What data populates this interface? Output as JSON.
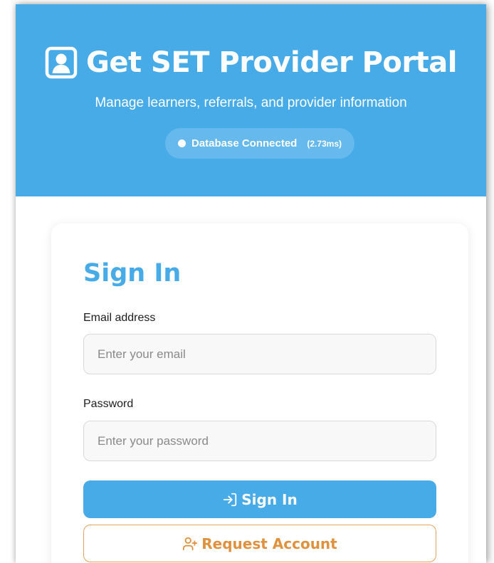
{
  "header": {
    "title": "Get SET Provider Portal",
    "subtitle": "Manage learners, referrals, and provider information",
    "status": {
      "label": "Database Connected",
      "latency": "(2.73ms)"
    }
  },
  "login": {
    "title": "Sign In",
    "email_label": "Email address",
    "email_placeholder": "Enter your email",
    "password_label": "Password",
    "password_placeholder": "Enter your password",
    "sign_in_label": "Sign In",
    "request_account_label": "Request Account"
  },
  "colors": {
    "primary": "#47abe8",
    "accent": "#e0913e",
    "background": "#ffffff"
  },
  "icons": {
    "portal": "user-square-icon",
    "sign_in": "login-arrow-icon",
    "request_account": "user-plus-icon"
  }
}
